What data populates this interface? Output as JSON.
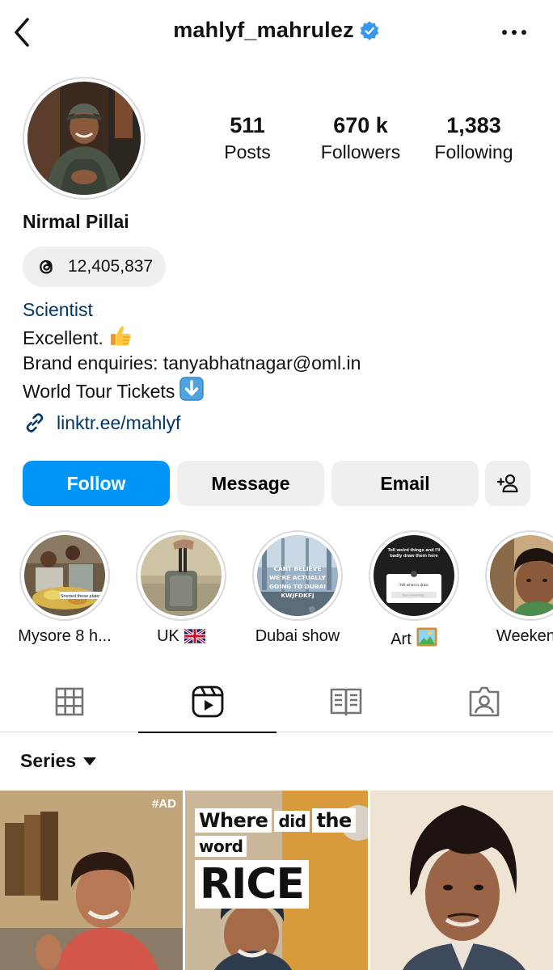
{
  "header": {
    "username": "mahlyf_mahrulez",
    "verified": true,
    "back_icon": "chevron-left-icon",
    "more_icon": "more-horizontal-icon"
  },
  "profile": {
    "full_name": "Nirmal Pillai",
    "stats": {
      "posts_value": "511",
      "posts_label": "Posts",
      "followers_value": "670 k",
      "followers_label": "Followers",
      "following_value": "1,383",
      "following_label": "Following"
    },
    "threads": {
      "icon": "threads-icon",
      "count": "12,405,837"
    },
    "bio": {
      "category": "Scientist",
      "line1": "Excellent.",
      "line2": "Brand enquiries: tanyabhatnagar@oml.in",
      "line3": "World Tour Tickets"
    },
    "link": {
      "icon": "link-icon",
      "text": "linktr.ee/mahlyf"
    }
  },
  "actions": {
    "follow_label": "Follow",
    "message_label": "Message",
    "email_label": "Email",
    "add_user_icon": "add-user-icon"
  },
  "highlights": [
    {
      "label": "Mysore 8 h...",
      "caption": "Snorted those plates"
    },
    {
      "label": "UK"
    },
    {
      "label": "Dubai show",
      "overlay": "CANT BELIEVE WE'RE ACTUALLY GOING TO DUBAI KWJFDKFJ"
    },
    {
      "label": "Art",
      "prompt": "Tell weird things and I'll badly draw them here",
      "box_title": "Tell what to draw",
      "box_placeholder": "Type something..."
    },
    {
      "label": "Weekend"
    }
  ],
  "tabs": [
    {
      "icon": "grid-icon",
      "active": false
    },
    {
      "icon": "reels-icon",
      "active": true
    },
    {
      "icon": "guides-icon",
      "active": false
    },
    {
      "icon": "tagged-icon",
      "active": false
    }
  ],
  "series": {
    "label": "Series"
  },
  "reels": [
    {
      "tag": "#AD"
    },
    {
      "title_words": [
        "Where",
        "did",
        "the",
        "word"
      ],
      "title_big": "RICE"
    },
    {}
  ],
  "colors": {
    "follow_blue": "#0095f6",
    "link_blue": "#00376b",
    "verified_blue": "#3897f0",
    "button_gray": "#efefef"
  }
}
